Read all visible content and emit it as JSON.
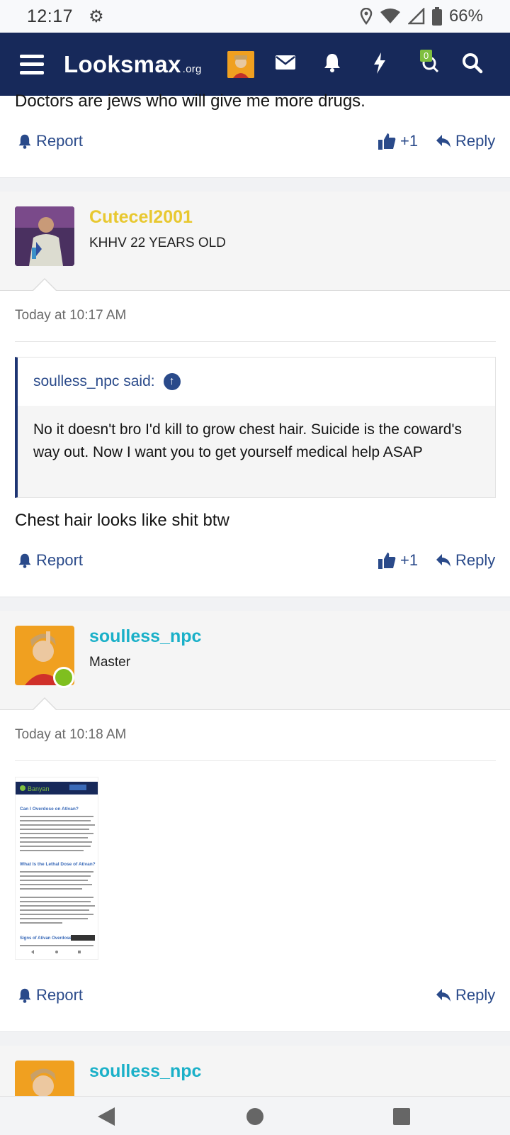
{
  "status_bar": {
    "time": "12:17",
    "battery": "66%"
  },
  "header": {
    "logo_main": "Looksmax",
    "logo_suffix": ".org",
    "icons": [
      "menu-icon",
      "avatar",
      "envelope-icon",
      "bell-icon",
      "bolt-icon",
      "chat-search-icon",
      "search-icon"
    ],
    "badge_count": "0"
  },
  "post0": {
    "text_partial": "Doctors are jews who will give me more drugs.",
    "report": "Report",
    "likes": "+1",
    "reply": "Reply"
  },
  "post1": {
    "username": "Cutecel2001",
    "user_title": "KHHV 22 YEARS OLD",
    "date": "Today at 10:17 AM",
    "quote_author": "soulless_npc said:",
    "quote_text": "No it doesn't bro I'd kill to grow chest hair. Suicide is the coward's way out. Now I want you to get yourself medical help ASAP",
    "body": "Chest hair looks like shit btw",
    "report": "Report",
    "likes": "+1",
    "reply": "Reply"
  },
  "post2": {
    "username": "soulless_npc",
    "user_title": "Master",
    "date": "Today at 10:18 AM",
    "attachment": {
      "brand": "Banyan",
      "heading1": "Can I Overdose on Ativan?",
      "heading2": "What Is the Lethal Dose of Ativan?",
      "heading3": "Signs of Ativan Overdose"
    },
    "report": "Report",
    "reply": "Reply"
  },
  "post3": {
    "username": "soulless_npc"
  },
  "colors": {
    "header_bg": "#17295a",
    "link": "#2a4a8a",
    "username_gold": "#e8c830",
    "username_teal": "#1ab0c8",
    "online": "#7fbf1f"
  }
}
